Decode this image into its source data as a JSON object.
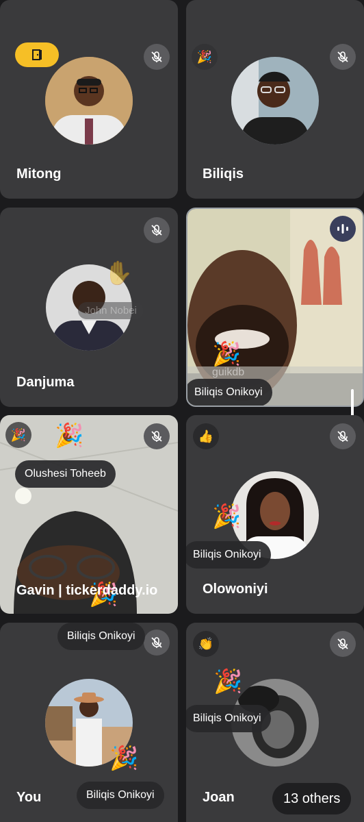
{
  "tiles": [
    {
      "id": "mitong",
      "name": "Mitong",
      "muted": true
    },
    {
      "id": "biliqis",
      "name": "Biliqis",
      "muted": true
    },
    {
      "id": "danjuma",
      "name": "Danjuma",
      "muted": true,
      "ghost_label": "John Nobei"
    },
    {
      "id": "speaker",
      "name": "",
      "speaking": true,
      "ghost_label": "guikdb"
    },
    {
      "id": "gavin",
      "name": "Gavin | tickerdaddy.io",
      "muted": true
    },
    {
      "id": "olowoniyi",
      "name": "Olowoniyi",
      "muted": true
    },
    {
      "id": "you",
      "name": "You",
      "muted": true
    },
    {
      "id": "joan",
      "name": "Joan",
      "muted": true
    }
  ],
  "reaction_chips": {
    "speaker": "Biliqis Onikoyi",
    "gavin_top": "Olushesi Toheeb",
    "olowoniyi": "Biliqis Onikoyi",
    "you_top": "Biliqis Onikoyi",
    "joan": "Biliqis Onikoyi",
    "you_bottom": "Biliqis Onikoyi"
  },
  "others_chip": "13 others",
  "reactions": {
    "olowoniyi": "👍",
    "joan": "👏",
    "party": "🎉"
  },
  "colors": {
    "tile": "#3a3a3c",
    "background": "#1b1b1d",
    "hand_raise_badge": "#f6bf26",
    "mic_bg": "#5b5b5e"
  }
}
